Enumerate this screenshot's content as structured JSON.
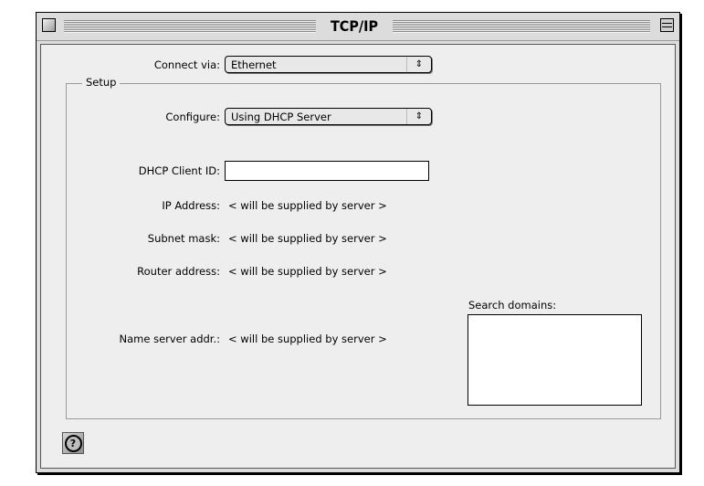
{
  "window": {
    "title": "TCP/IP",
    "close_icon": "close-box",
    "collapse_icon": "collapse-box"
  },
  "connect_via": {
    "label": "Connect via:",
    "selected": "Ethernet",
    "arrows": "⇕"
  },
  "setup": {
    "legend": "Setup",
    "configure": {
      "label": "Configure:",
      "selected": "Using DHCP Server",
      "arrows": "⇕"
    },
    "dhcp_client_id": {
      "label": "DHCP Client ID:",
      "value": ""
    },
    "fields": [
      {
        "label": "IP Address:",
        "value": "< will be supplied by server >"
      },
      {
        "label": "Subnet mask:",
        "value": "< will be supplied by server >"
      },
      {
        "label": "Router address:",
        "value": "< will be supplied by server >"
      },
      {
        "label": "Name server addr.:",
        "value": "< will be supplied by server >"
      }
    ],
    "search_domains": {
      "label": "Search domains:",
      "value": ""
    }
  },
  "help": {
    "label": "?"
  }
}
